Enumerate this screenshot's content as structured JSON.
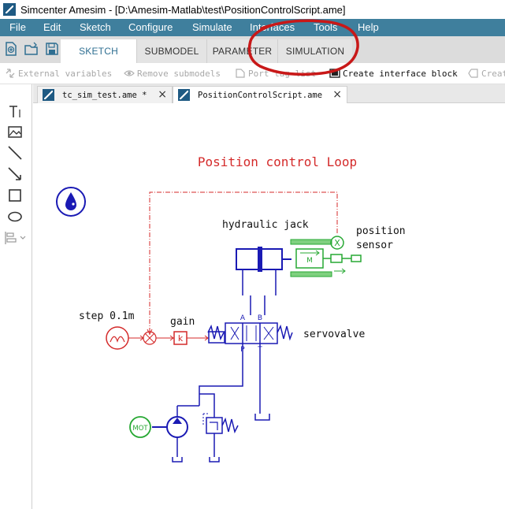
{
  "window": {
    "title": "Simcenter Amesim - [D:\\Amesim-Matlab\\test\\PositionControlScript.ame]"
  },
  "menu": {
    "items": [
      "File",
      "Edit",
      "Sketch",
      "Configure",
      "Simulate",
      "Interfaces",
      "Tools",
      "Help"
    ]
  },
  "ribbon": {
    "tabs": [
      "SKETCH",
      "SUBMODEL",
      "PARAMETER",
      "SIMULATION"
    ],
    "active_tab": "SKETCH"
  },
  "commands": {
    "external_variables": "External variables",
    "remove_submodels": "Remove submodels",
    "port_tag_list": "Port tag list",
    "create_interface_block": "Create interface block",
    "create_truncated": "Creat"
  },
  "document_tabs": [
    {
      "label": "tc_sim_test.ame *",
      "close": "×"
    },
    {
      "label": "PositionControlScript.ame",
      "close": "×"
    }
  ],
  "sketch": {
    "title": "Position control Loop",
    "labels": {
      "jack": "hydraulic jack",
      "sensor_line1": "position",
      "sensor_line2": "sensor",
      "step": "step 0.1m",
      "gain": "gain",
      "servovalve": "servovalve",
      "motor": "MOT",
      "gain_symbol": "k",
      "mass": "M",
      "sensor_symbol": "X",
      "port_a": "A",
      "port_b": "B",
      "port_p": "P",
      "port_t": "T"
    }
  },
  "colors": {
    "menubar": "#3f7f9d",
    "active_tab_text": "#2f6f92",
    "hydraulic": "#1a1ab4",
    "signal": "#d42a2a",
    "mechanical": "#27a833",
    "annotation": "#c81818"
  }
}
